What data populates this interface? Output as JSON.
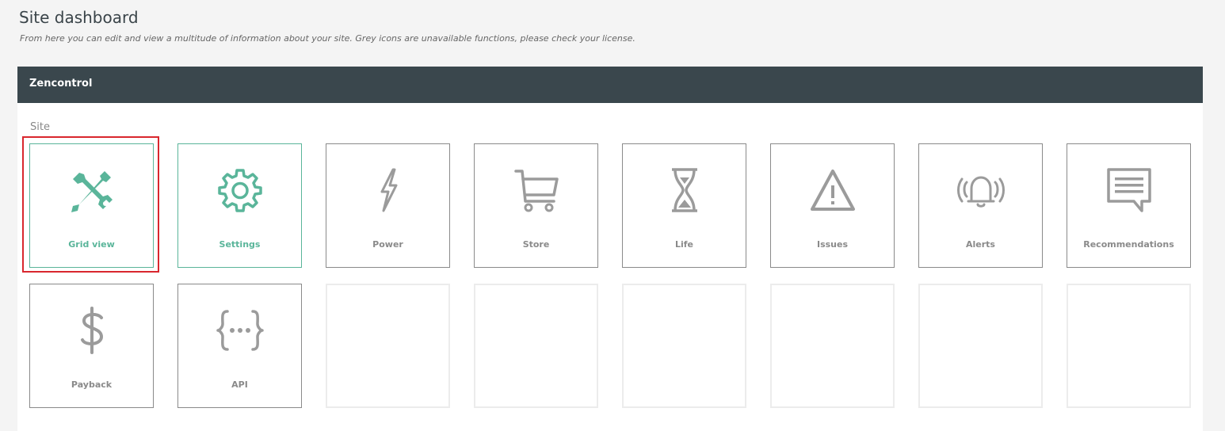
{
  "header": {
    "title": "Site dashboard",
    "subtitle": "From here you can edit and view a multitude of information about your site. Grey icons are unavailable functions, please check your license."
  },
  "panel": {
    "title": "Zencontrol",
    "section_label": "Site"
  },
  "colors": {
    "active": "#5ab59a",
    "inactive": "#8a8a8a",
    "header_bg": "#3a474d",
    "highlight": "#d9272e"
  },
  "tiles": [
    {
      "label": "Grid view",
      "icon": "tools-icon",
      "active": true,
      "highlighted": true
    },
    {
      "label": "Settings",
      "icon": "gear-icon",
      "active": true
    },
    {
      "label": "Power",
      "icon": "lightning-bolt-icon",
      "active": false
    },
    {
      "label": "Store",
      "icon": "shopping-cart-icon",
      "active": false
    },
    {
      "label": "Life",
      "icon": "hourglass-icon",
      "active": false
    },
    {
      "label": "Issues",
      "icon": "warning-triangle-icon",
      "active": false
    },
    {
      "label": "Alerts",
      "icon": "alarm-bell-icon",
      "active": false
    },
    {
      "label": "Recommendations",
      "icon": "message-icon",
      "active": false
    },
    {
      "label": "Payback",
      "icon": "dollar-icon",
      "active": false
    },
    {
      "label": "API",
      "icon": "api-braces-icon",
      "active": false
    }
  ]
}
